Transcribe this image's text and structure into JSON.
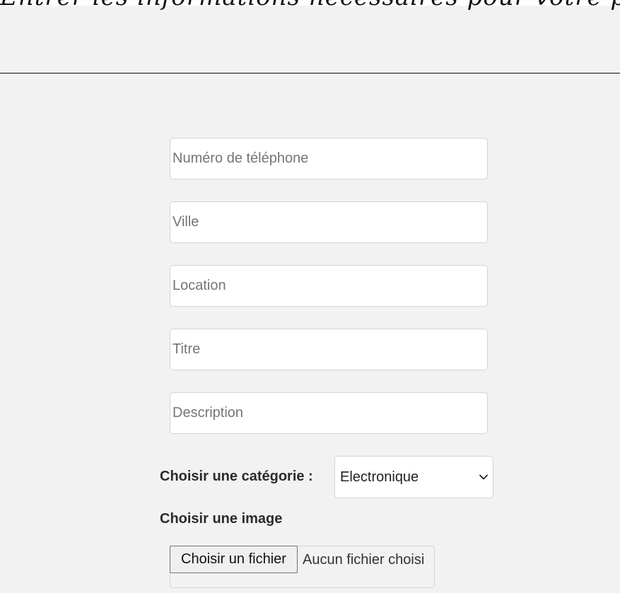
{
  "page": {
    "heading": "Entrer les informations nécessaires pour votre poste"
  },
  "form": {
    "fields": {
      "phone": {
        "placeholder": "Numéro de téléphone",
        "value": ""
      },
      "city": {
        "placeholder": "Ville",
        "value": ""
      },
      "location": {
        "placeholder": "Location",
        "value": ""
      },
      "title": {
        "placeholder": "Titre",
        "value": ""
      },
      "description": {
        "placeholder": "Description",
        "value": ""
      }
    },
    "category": {
      "label": "Choisir une catégorie :",
      "selected": "Electronique",
      "icon": "chevron-down-icon"
    },
    "image": {
      "label": "Choisir une image",
      "button_label": "Choisir un fichier",
      "status": "Aucun fichier choisi"
    }
  }
}
